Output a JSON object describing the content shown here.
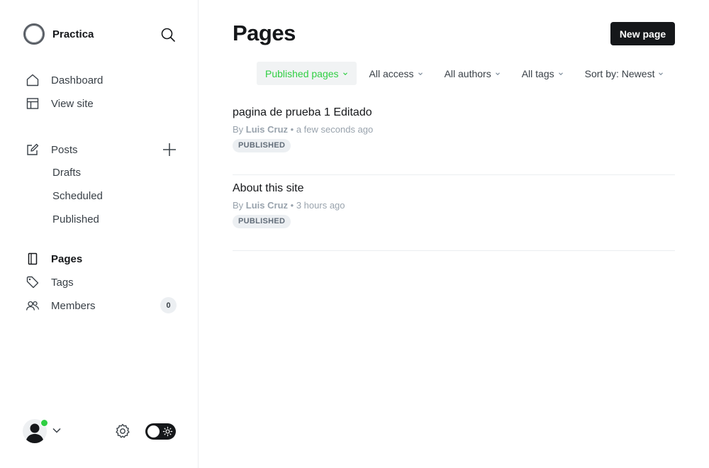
{
  "brand": {
    "name": "Practica"
  },
  "sidebar": {
    "nav": [
      {
        "label": "Dashboard",
        "icon": "home-icon"
      },
      {
        "label": "View site",
        "icon": "layout-icon"
      }
    ],
    "posts": {
      "label": "Posts",
      "icon": "edit-icon",
      "sub": [
        "Drafts",
        "Scheduled",
        "Published"
      ]
    },
    "secondary": [
      {
        "label": "Pages",
        "icon": "page-icon",
        "active": true
      },
      {
        "label": "Tags",
        "icon": "tag-icon"
      },
      {
        "label": "Members",
        "icon": "members-icon",
        "count": "0"
      }
    ]
  },
  "main": {
    "title": "Pages",
    "new_button": "New page",
    "filters": [
      {
        "label": "Published pages",
        "selected": true
      },
      {
        "label": "All access"
      },
      {
        "label": "All authors"
      },
      {
        "label": "All tags"
      },
      {
        "label": "Sort by: Newest"
      }
    ],
    "pages": [
      {
        "title": "pagina de prueba 1 Editado",
        "by": "By",
        "author": "Luis Cruz",
        "time": "a few seconds ago",
        "status": "PUBLISHED"
      },
      {
        "title": "About this site",
        "by": "By",
        "author": "Luis Cruz",
        "time": "3 hours ago",
        "status": "PUBLISHED"
      }
    ]
  },
  "colors": {
    "accent": "#30cf43",
    "text": "#15171a",
    "muted": "#99a3ad"
  }
}
